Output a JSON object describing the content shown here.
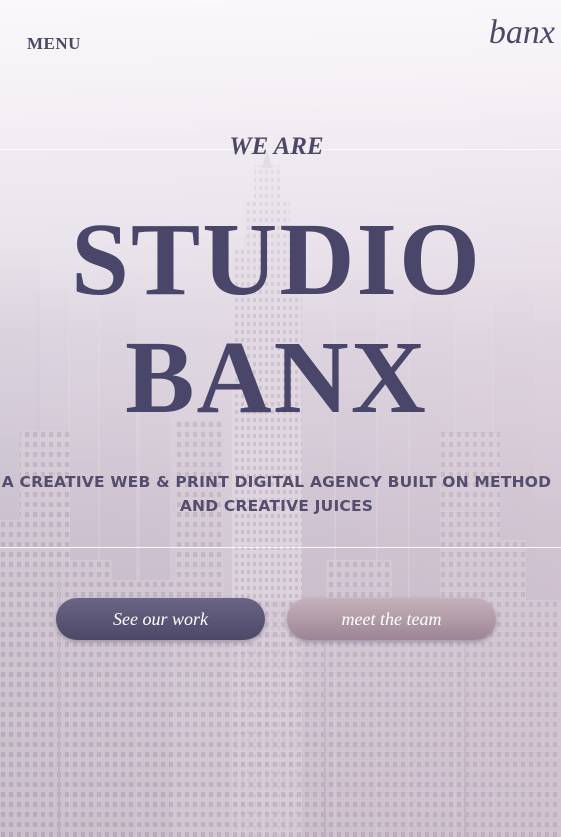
{
  "header": {
    "menu_label": "MENU",
    "logo_text": "banx"
  },
  "hero": {
    "intro": "WE ARE",
    "title_line1": "STUDIO",
    "title_line2": "BANX",
    "tagline_line1": "A CREATIVE WEB & PRINT DIGITAL AGENCY BUILT ON METHOD",
    "tagline_line2": "AND CREATIVE JUICES"
  },
  "buttons": {
    "work_label": "See our work",
    "team_label": "meet the team"
  },
  "colors": {
    "text_primary": "#49466a",
    "button_dark": "#5a5576",
    "button_light": "#b29da9",
    "button_text": "#ffffff"
  },
  "background": {
    "image_name": "city-skyline-photo"
  }
}
